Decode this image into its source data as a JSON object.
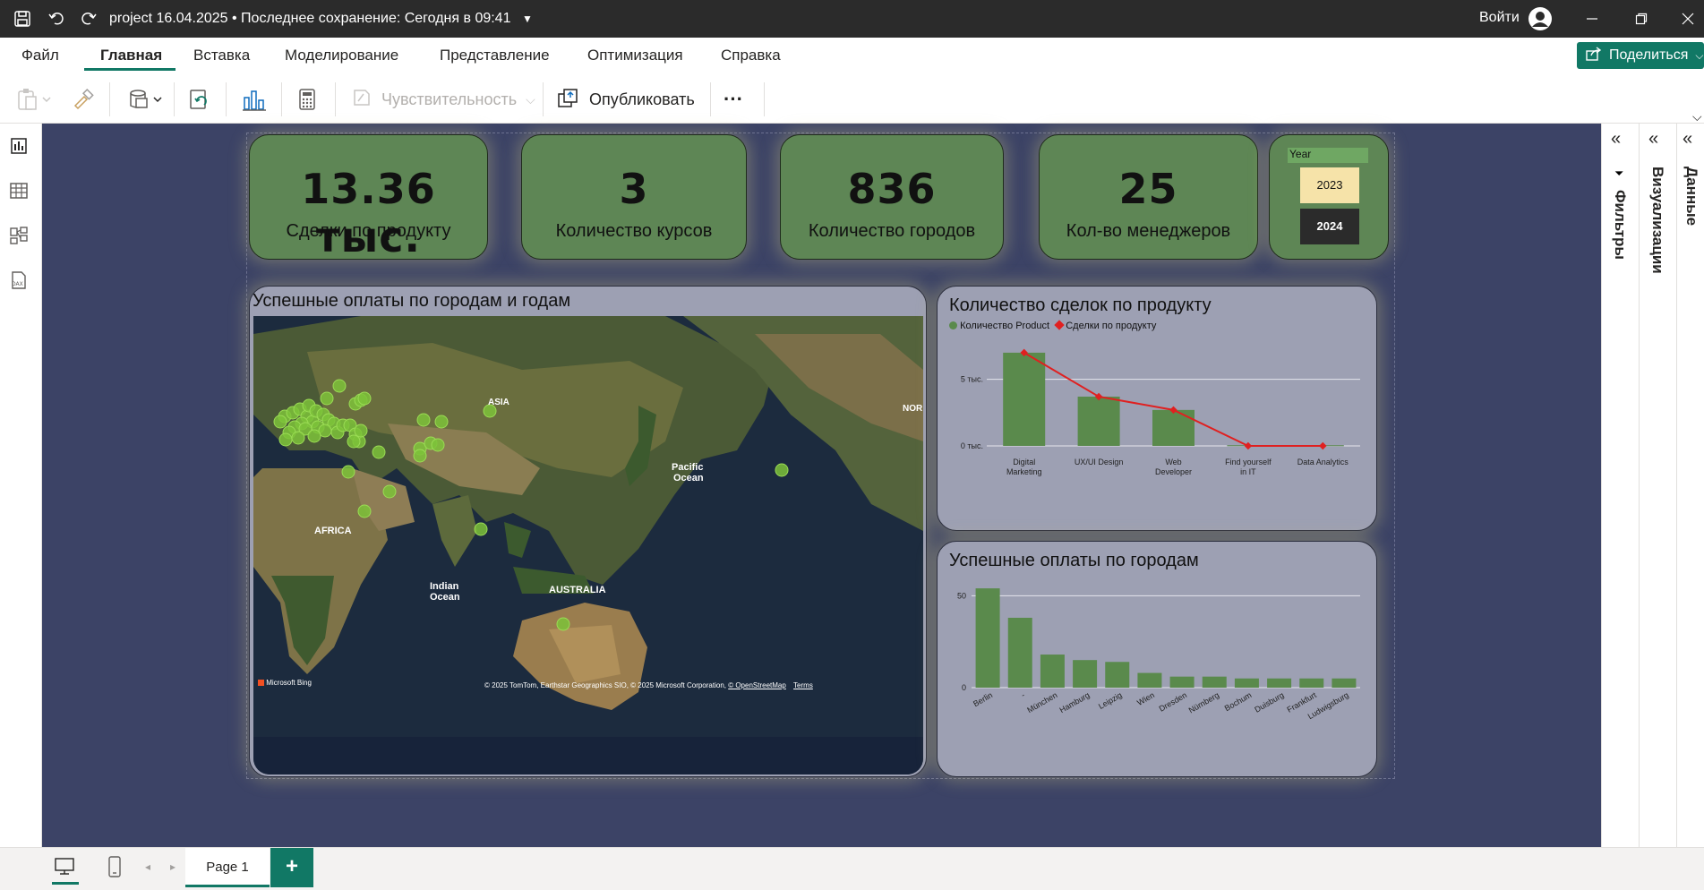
{
  "titlebar": {
    "title": "project 16.04.2025 • Последнее сохранение: Сегодня в 09:41",
    "signin": "Войти"
  },
  "menu": {
    "items": [
      "Файл",
      "Главная",
      "Вставка",
      "Моделирование",
      "Представление",
      "Оптимизация",
      "Справка"
    ],
    "active": "Главная",
    "share": "Поделиться"
  },
  "ribbon": {
    "sensitivity": "Чувствительность",
    "publish": "Опубликовать",
    "more": "···"
  },
  "kpis": [
    {
      "value": "13.36 тыс.",
      "label": "Сделки по продукту"
    },
    {
      "value": "3",
      "label": "Количество курсов"
    },
    {
      "value": "836",
      "label": "Количество городов"
    },
    {
      "value": "25",
      "label": "Кол-во менеджеров"
    }
  ],
  "slicer": {
    "title": "Year",
    "options": [
      "2023",
      "2024"
    ],
    "selected": "2024"
  },
  "map": {
    "title": "Успешные оплаты по городам и годам",
    "labels": [
      "ASIA",
      "NOR",
      "Pacific",
      "Ocean",
      "AFRICA",
      "Indian",
      "Ocean",
      "AUSTRALIA"
    ],
    "copyright": "© 2025 TomTom, Earthstar Geographics SIO, © 2025 Microsoft Corporation,",
    "osm": "© OpenStreetMap",
    "terms": "Terms",
    "bing": "Microsoft Bing"
  },
  "chart_data": [
    {
      "type": "bar",
      "title": "Количество сделок по продукту",
      "categories": [
        "Digital Marketing",
        "UX/UI Design",
        "Web Developer",
        "Find yourself in IT",
        "Data Analytics"
      ],
      "category_lines": [
        [
          "Digital",
          "Marketing"
        ],
        [
          "UX/UI Design"
        ],
        [
          "Web",
          "Developer"
        ],
        [
          "Find yourself",
          "in IT"
        ],
        [
          "Data Analytics"
        ]
      ],
      "series": [
        {
          "name": "Количество Product",
          "type": "bar",
          "color": "#5a8a4c",
          "values": [
            7000,
            3700,
            2700,
            50,
            50
          ]
        },
        {
          "name": "Сделки по продукту",
          "type": "line",
          "color": "#e02020",
          "values": [
            7000,
            3700,
            2700,
            0,
            0
          ]
        }
      ],
      "yticks": [
        "0 тыс.",
        "5 тыс."
      ],
      "ytick_values": [
        0,
        5000
      ],
      "ylim": [
        0,
        7800
      ],
      "legend": "top-left"
    },
    {
      "type": "bar",
      "title": "Успешные оплаты по городам",
      "categories": [
        "Berlin",
        "-",
        "München",
        "Hamburg",
        "Leipzig",
        "Wien",
        "Dresden",
        "Nürnberg",
        "Bochum",
        "Duisburg",
        "Frankfurt",
        "Ludwigsburg"
      ],
      "values": [
        54,
        38,
        18,
        15,
        14,
        8,
        6,
        6,
        5,
        5,
        5,
        5
      ],
      "color": "#5a8a4c",
      "yticks": [
        "0",
        "50"
      ],
      "ytick_values": [
        0,
        50
      ],
      "ylim": [
        0,
        56
      ]
    }
  ],
  "pages": {
    "tab": "Page 1",
    "add": "+"
  },
  "panes": {
    "filters": "Фильтры",
    "visualizations": "Визуализации",
    "data": "Данные"
  }
}
